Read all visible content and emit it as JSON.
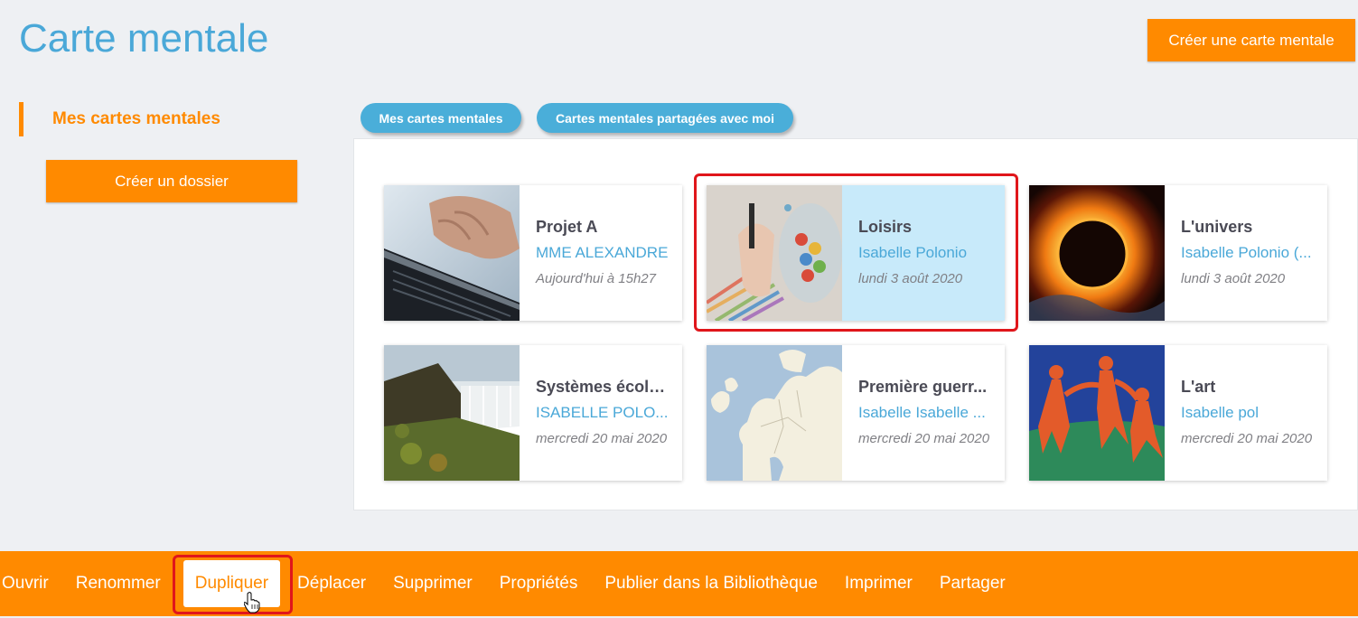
{
  "header": {
    "title": "Carte mentale",
    "create_map_label": "Créer une carte mentale"
  },
  "sidebar": {
    "section_title": "Mes cartes mentales",
    "create_folder_label": "Créer un dossier"
  },
  "tabs": [
    {
      "label": "Mes cartes mentales"
    },
    {
      "label": "Cartes mentales partagées avec moi"
    }
  ],
  "cards": [
    {
      "title": "Projet A",
      "owner": "MME ALEXANDRE",
      "date": "Aujourd'hui à 15h27",
      "thumbnail": "laptop-typing-image"
    },
    {
      "title": "Loisirs",
      "owner": "Isabelle Polonio",
      "date": "lundi 3 août 2020",
      "thumbnail": "crayons-jar-image",
      "selected": true
    },
    {
      "title": "L'univers",
      "owner": "Isabelle Polonio (...",
      "date": "lundi 3 août 2020",
      "thumbnail": "eclipse-image"
    },
    {
      "title": "Systèmes écolo...",
      "owner": "ISABELLE POLO...",
      "date": "mercredi 20 mai 2020",
      "thumbnail": "waterfall-image"
    },
    {
      "title": "Première guerr...",
      "owner": "Isabelle Isabelle ...",
      "date": "mercredi 20 mai 2020",
      "thumbnail": "europe-map-image"
    },
    {
      "title": "L'art",
      "owner": "Isabelle pol",
      "date": "mercredi 20 mai 2020",
      "thumbnail": "dance-painting-image"
    }
  ],
  "actions": [
    {
      "label": "Ouvrir"
    },
    {
      "label": "Renommer"
    },
    {
      "label": "Dupliquer",
      "active": true
    },
    {
      "label": "Déplacer"
    },
    {
      "label": "Supprimer"
    },
    {
      "label": "Propriétés"
    },
    {
      "label": "Publier dans la Bibliothèque"
    },
    {
      "label": "Imprimer"
    },
    {
      "label": "Partager"
    }
  ],
  "colors": {
    "accent_orange": "#ff8a00",
    "title_blue": "#4aa8d8",
    "selection_bg": "#c8eafa",
    "highlight_red": "#e0161b"
  }
}
